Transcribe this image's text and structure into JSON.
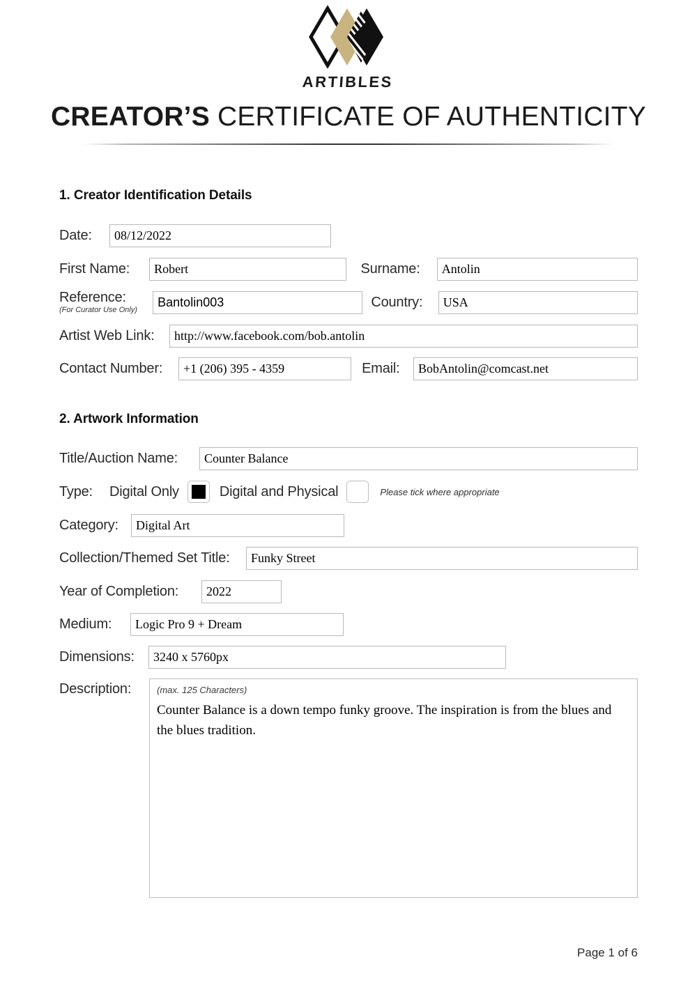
{
  "brand": {
    "wordmark": "ARTIBLES",
    "logo_icon": "artibles-diamonds-logo",
    "gold": "#c9b37e",
    "black": "#111111"
  },
  "header": {
    "title_strong": "CREATOR’S",
    "title_rest": "CERTIFICATE OF AUTHENTICITY"
  },
  "section1": {
    "heading": "1. Creator Identification Details",
    "date": {
      "label": "Date:",
      "value": "08/12/2022"
    },
    "first_name": {
      "label": "First Name:",
      "value": "Robert"
    },
    "surname": {
      "label": "Surname:",
      "value": "Antolin"
    },
    "reference": {
      "label": "Reference:",
      "sublabel": "(For Curator Use Only)",
      "value": "Bantolin003"
    },
    "country": {
      "label": "Country:",
      "value": "USA"
    },
    "web_link": {
      "label": "Artist Web Link:",
      "value": "http://www.facebook.com/bob.antolin"
    },
    "contact_number": {
      "label": "Contact Number:",
      "value": "+1 (206) 395 - 4359"
    },
    "email": {
      "label": "Email:",
      "value": "BobAntolin@comcast.net"
    }
  },
  "section2": {
    "heading": "2. Artwork Information",
    "title_auction": {
      "label": "Title/Auction Name:",
      "value": "Counter Balance"
    },
    "type": {
      "label": "Type:",
      "option_digital_only": "Digital Only",
      "option_digital_physical": "Digital and Physical",
      "digital_only_checked": true,
      "digital_physical_checked": false,
      "hint": "Please tick where appropriate"
    },
    "category": {
      "label": "Category:",
      "value": "Digital Art"
    },
    "collection": {
      "label": "Collection/Themed Set Title:",
      "value": "Funky Street"
    },
    "year": {
      "label": "Year of Completion:",
      "value": "2022"
    },
    "medium": {
      "label": "Medium:",
      "value": "Logic Pro 9 + Dream"
    },
    "dimensions": {
      "label": "Dimensions:",
      "value": "3240 x 5760px"
    },
    "description": {
      "label": "Description:",
      "hint": "(max. 125 Characters)",
      "value": "Counter Balance is a down tempo funky groove. The inspiration is from the blues and the blues tradition."
    }
  },
  "footer": {
    "page": "Page 1 of 6"
  }
}
